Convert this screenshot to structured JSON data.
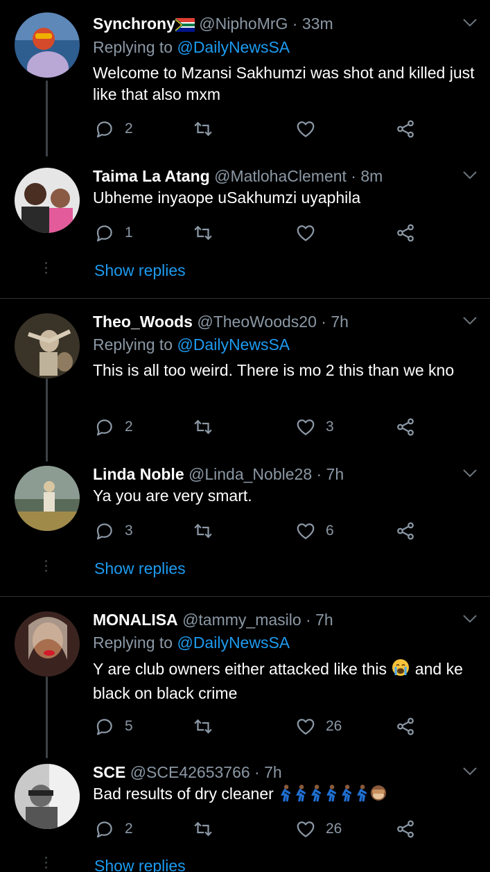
{
  "tweets": [
    {
      "name": "Synchrony",
      "handle": "@NiphoMrG · 33m",
      "replying_label": "Replying to",
      "replying_to": "@DailyNewsSA",
      "text": "Welcome to Mzansi Sakhumzi was shot and killed just like that also mxm",
      "replies": "2",
      "retweets": "",
      "likes": "",
      "avatar_color": "#2e5d8f"
    },
    {
      "name": "Taima La Atang",
      "handle": "@MatlohaClement · 8m",
      "text": "Ubheme inyaope uSakhumzi uyaphila",
      "replies": "1",
      "retweets": "",
      "likes": "",
      "avatar_color": "#6b4a3a"
    },
    {
      "name": "Theo_Woods",
      "handle": "@TheoWoods20 · 7h",
      "replying_label": "Replying to",
      "replying_to": "@DailyNewsSA",
      "text": "This is all too weird. There is mo 2 this than we kno",
      "replies": "2",
      "retweets": "",
      "likes": "3",
      "avatar_color": "#3a3328"
    },
    {
      "name": "Linda Noble",
      "handle": "@Linda_Noble28 · 7h",
      "text": "Ya you are very smart.",
      "replies": "3",
      "retweets": "",
      "likes": "6",
      "avatar_color": "#5a6a58"
    },
    {
      "name": "MONALISA",
      "handle": "@tammy_masilo · 7h",
      "replying_label": "Replying to",
      "replying_to": "@DailyNewsSA",
      "text_before_emoji": "Y are club owners  either attacked like this ",
      "text_after_emoji": " and ke black on black crime",
      "replies": "5",
      "retweets": "",
      "likes": "26",
      "avatar_color": "#3b2420"
    },
    {
      "name": "SCE",
      "handle": "@SCE42653766 · 7h",
      "text": "Bad results of dry cleaner",
      "replies": "2",
      "retweets": "",
      "likes": "26",
      "avatar_color": "#9a9a9a"
    }
  ],
  "show_replies": "Show replies",
  "colors": {
    "background": "#000000",
    "accent": "#1d9bf0",
    "muted": "#8b98a5",
    "divider": "#2f3336"
  },
  "icons": [
    "reply-icon",
    "retweet-icon",
    "like-icon",
    "share-icon",
    "chevron-down-icon",
    "south-africa-flag-icon",
    "crying-face-icon",
    "running-man-icon",
    "see-no-evil-monkey-icon"
  ]
}
